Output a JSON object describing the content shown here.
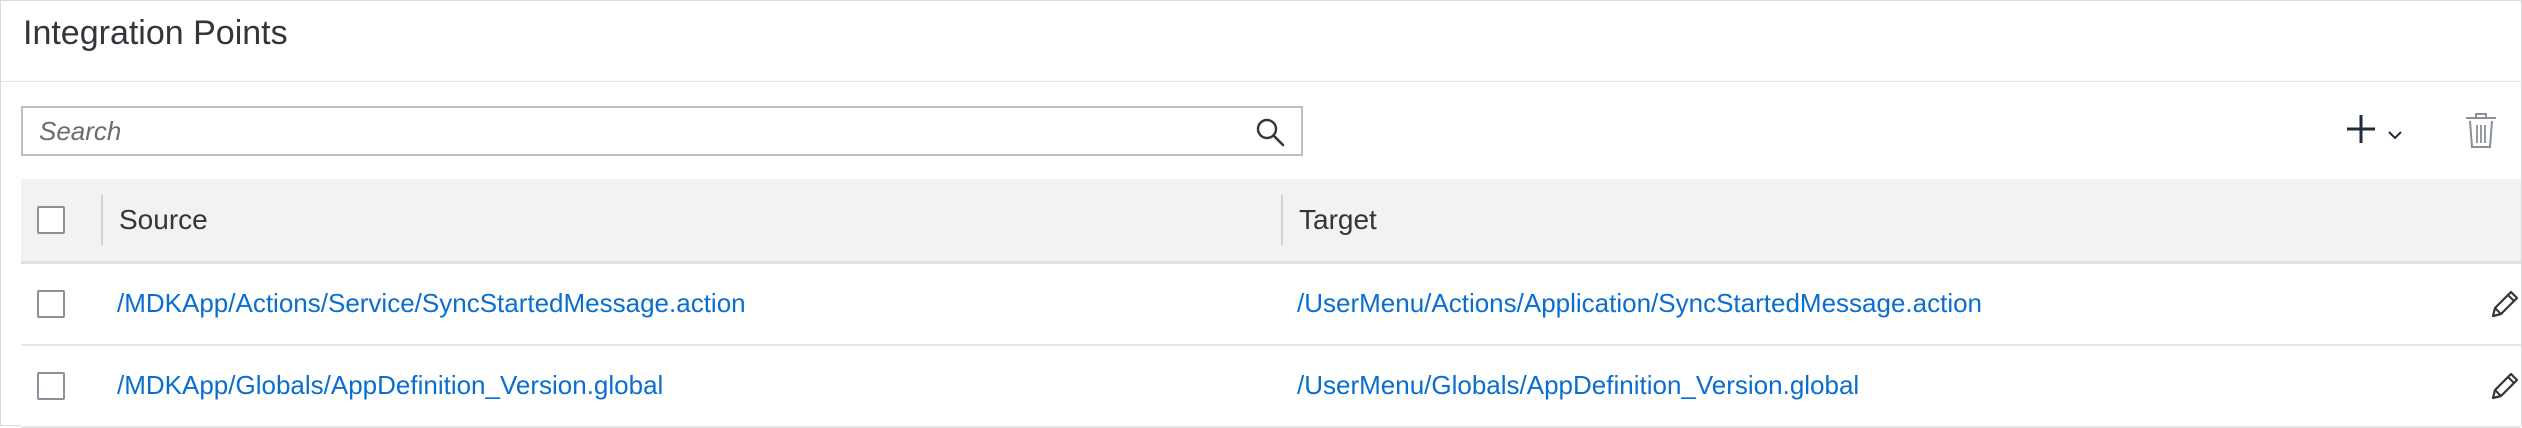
{
  "panel": {
    "title": "Integration Points"
  },
  "search": {
    "placeholder": "Search",
    "value": ""
  },
  "toolbar": {
    "add_icon": "plus-icon",
    "add_menu_icon": "chevron-down-icon",
    "delete_icon": "trash-icon"
  },
  "table": {
    "columns": [
      "Source",
      "Target"
    ],
    "rows": [
      {
        "source": "/MDKApp/Actions/Service/SyncStartedMessage.action",
        "target": "/UserMenu/Actions/Application/SyncStartedMessage.action"
      },
      {
        "source": "/MDKApp/Globals/AppDefinition_Version.global",
        "target": "/UserMenu/Globals/AppDefinition_Version.global"
      }
    ]
  },
  "colors": {
    "link": "#0a6ed1",
    "header_bg": "#f2f2f2",
    "text": "#32363a"
  }
}
